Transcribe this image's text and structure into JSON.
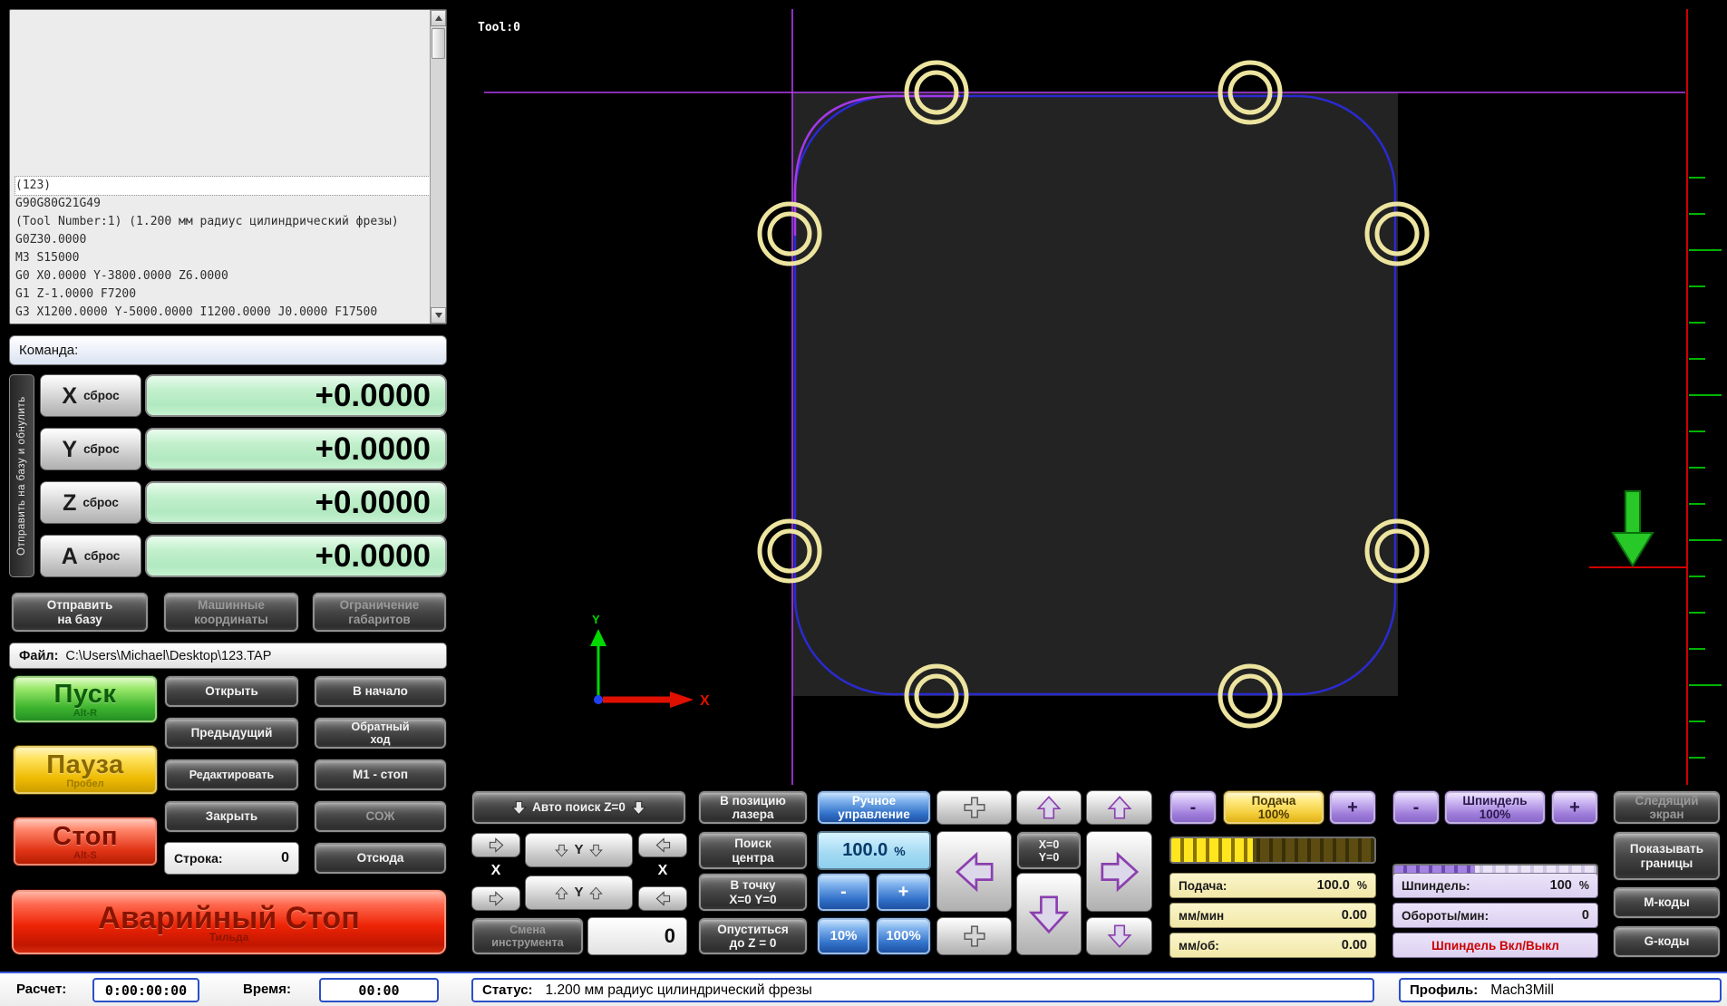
{
  "colors": {
    "accent_blue": "#2f6cc8",
    "feed_yellow": "#ffe61e",
    "spindle_purple": "#9f7dda",
    "dro_green": "#c2f0cc",
    "alert_red": "#e23416"
  },
  "gcode": {
    "lines": [
      "(123)",
      "G90G80G21G49",
      "(Tool Number:1) (1.200 мм радиус цилиндрический фрезы)",
      "G0Z30.0000",
      "M3 S15000",
      "G0 X0.0000 Y-3800.0000 Z6.0000",
      "G1   Z-1.0000 F7200",
      "G3 X1200.0000 Y-5000.0000 I1200.0000 J0.0000 F17500"
    ]
  },
  "command": {
    "label": "Команда:"
  },
  "dro": {
    "side_label": "Отправить на базу и обнулить",
    "axes": [
      {
        "letter": "X",
        "button": "сброс",
        "value": "+0.0000"
      },
      {
        "letter": "Y",
        "button": "сброс",
        "value": "+0.0000"
      },
      {
        "letter": "Z",
        "button": "сброс",
        "value": "+0.0000"
      },
      {
        "letter": "A",
        "button": "сброс",
        "value": "+0.0000"
      }
    ],
    "ref_line1": "Отправить",
    "ref_line2": "на базу",
    "mach_line1": "Машинные",
    "mach_line2": "координаты",
    "lim_line1": "Ограничение",
    "lim_line2": "габаритов"
  },
  "file": {
    "label": "Файл:",
    "path": "C:\\Users\\Michael\\Desktop\\123.TAP"
  },
  "run": {
    "start": "Пуск",
    "start_key": "Alt-R",
    "open": "Открыть",
    "rewind": "В начало",
    "prev": "Предыдущий",
    "rev_line1": "Обратный",
    "rev_line2": "ход",
    "pause": "Пауза",
    "pause_key": "Пробел",
    "edit": "Редактировать",
    "m1": "M1 - стоп",
    "close": "Закрыть",
    "coolant": "СОЖ",
    "stop": "Стоп",
    "stop_key": "Alt-S",
    "line_label": "Строка:",
    "line_value": "0",
    "from_here": "Отсюда",
    "estop": "Аварийный Стоп",
    "estop_key": "Тильда"
  },
  "display": {
    "tool": "Tool:0"
  },
  "jog": {
    "auto_z": "Авто поиск Z=0",
    "laser_line1": "В позицию",
    "laser_line2": "лазера",
    "manual_line1": "Ручное",
    "manual_line2": "управление",
    "center_line1": "Поиск",
    "center_line2": "центра",
    "goto_line1": "В точку",
    "goto_line2": "X=0 Y=0",
    "drop_line1": "Опуститься",
    "drop_line2": "до Z = 0",
    "pct_value": "100.0",
    "pct_unit": "%",
    "minus": "-",
    "plus": "+",
    "pct10": "10%",
    "pct100": "100%",
    "x_label": "X",
    "y_label": "Y",
    "xy0_line1": "X=0",
    "xy0_line2": "Y=0",
    "tc_line1": "Смена",
    "tc_line2": "инструмента",
    "tool_number": "0"
  },
  "feed": {
    "minus": "-",
    "plus": "+",
    "t1": "Подача",
    "t2": "100%",
    "label": "Подача:",
    "value": "100.0",
    "unit": "%",
    "mmmin_label": "мм/мин",
    "mmmin_value": "0.00",
    "mmrev_label": "мм/об:",
    "mmrev_value": "0.00"
  },
  "spindle": {
    "minus": "-",
    "plus": "+",
    "t1": "Шпиндель",
    "t2": "100%",
    "label": "Шпиндель:",
    "value": "100",
    "unit": "%",
    "rpm_label": "Обороты/мин:",
    "rpm_value": "0",
    "toggle": "Шпиндель Вкл/Выкл"
  },
  "rightcol": {
    "track1": "Следящий",
    "track2": "экран",
    "bounds1": "Показывать",
    "bounds2": "границы",
    "mcodes": "М-коды",
    "gcodes": "G-коды"
  },
  "statusbar": {
    "calc_label": "Расчет:",
    "calc_value": "0:00:00:00",
    "time_label": "Время:",
    "time_value": "00:00",
    "status_label": "Статус:",
    "status_value": "1.200 мм радиус цилиндрический фрезы",
    "profile_label": "Профиль:",
    "profile_value": "Mach3Mill"
  }
}
